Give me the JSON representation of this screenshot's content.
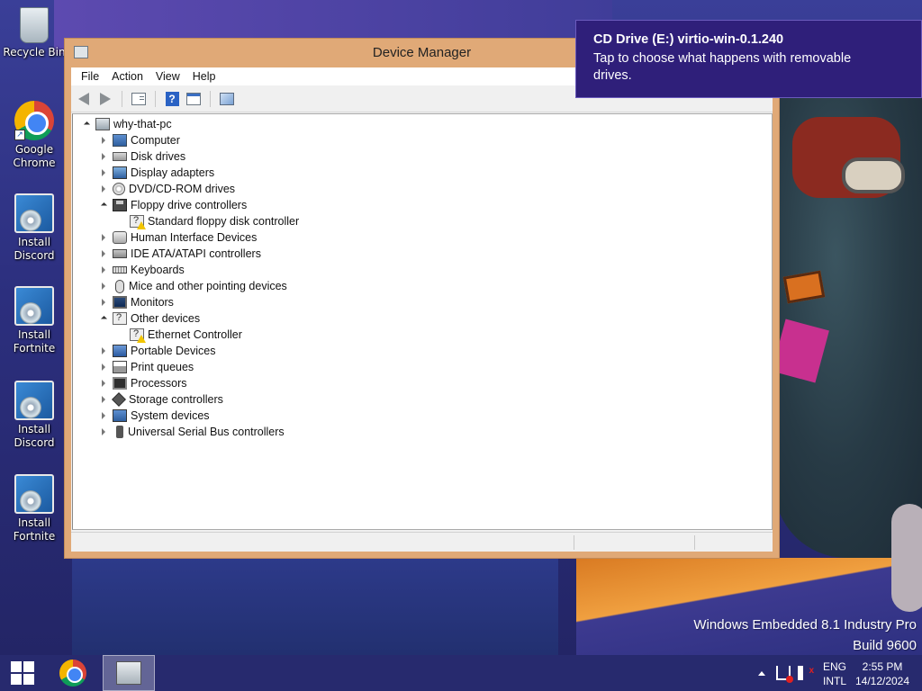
{
  "desktop": {
    "icons": [
      {
        "label": "Recycle Bin",
        "icon": "recycle-bin-icon"
      },
      {
        "label": "Google Chrome",
        "icon": "chrome-icon"
      },
      {
        "label": "Install Discord",
        "icon": "installer-icon"
      },
      {
        "label": "Install Fortnite",
        "icon": "installer-icon"
      },
      {
        "label": "Install Discord",
        "icon": "installer-icon"
      },
      {
        "label": "Install Fortnite",
        "icon": "installer-icon"
      }
    ]
  },
  "window": {
    "title": "Device Manager",
    "menu": [
      "File",
      "Action",
      "View",
      "Help"
    ],
    "toolbar": [
      "back-icon",
      "forward-icon",
      "show-hide-tree-icon",
      "help-icon",
      "properties-icon",
      "scan-hardware-icon"
    ]
  },
  "tree": {
    "root": "why-that-pc",
    "categories": [
      {
        "label": "Computer",
        "icon": "computer-icon",
        "expanded": false
      },
      {
        "label": "Disk drives",
        "icon": "disk-drive-icon",
        "expanded": false
      },
      {
        "label": "Display adapters",
        "icon": "display-adapter-icon",
        "expanded": false
      },
      {
        "label": "DVD/CD-ROM drives",
        "icon": "dvd-drive-icon",
        "expanded": false
      },
      {
        "label": "Floppy drive controllers",
        "icon": "floppy-controller-icon",
        "expanded": true,
        "children": [
          {
            "label": "Standard floppy disk controller",
            "warning": true
          }
        ]
      },
      {
        "label": "Human Interface Devices",
        "icon": "hid-icon",
        "expanded": false
      },
      {
        "label": "IDE ATA/ATAPI controllers",
        "icon": "ide-controller-icon",
        "expanded": false
      },
      {
        "label": "Keyboards",
        "icon": "keyboard-icon",
        "expanded": false
      },
      {
        "label": "Mice and other pointing devices",
        "icon": "mouse-icon",
        "expanded": false
      },
      {
        "label": "Monitors",
        "icon": "monitor-icon",
        "expanded": false
      },
      {
        "label": "Other devices",
        "icon": "other-devices-icon",
        "expanded": true,
        "children": [
          {
            "label": "Ethernet Controller",
            "warning": true
          }
        ]
      },
      {
        "label": "Portable Devices",
        "icon": "portable-device-icon",
        "expanded": false
      },
      {
        "label": "Print queues",
        "icon": "printer-icon",
        "expanded": false
      },
      {
        "label": "Processors",
        "icon": "processor-icon",
        "expanded": false
      },
      {
        "label": "Storage controllers",
        "icon": "storage-controller-icon",
        "expanded": false
      },
      {
        "label": "System devices",
        "icon": "system-devices-icon",
        "expanded": false
      },
      {
        "label": "Universal Serial Bus controllers",
        "icon": "usb-icon",
        "expanded": false
      }
    ]
  },
  "toast": {
    "title": "CD Drive (E:) virtio-win-0.1.240",
    "body": "Tap to choose what happens with removable drives."
  },
  "watermark": {
    "line1": "Windows Embedded 8.1 Industry Pro",
    "line2": "Build 9600"
  },
  "taskbar": {
    "lang_line1": "ENG",
    "lang_line2": "INTL",
    "time": "2:55 PM",
    "date": "14/12/2024"
  },
  "colors": {
    "window_frame": "#e0a977",
    "toast_bg": "#2f1f7a",
    "taskbar_bg": "#272a6e"
  }
}
